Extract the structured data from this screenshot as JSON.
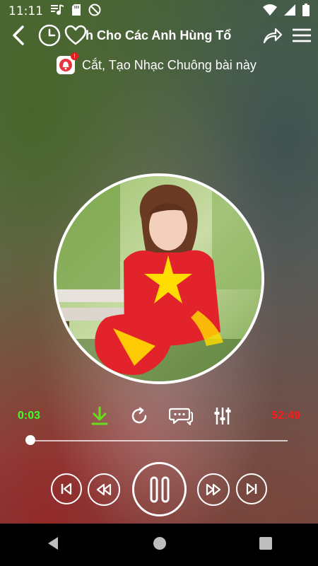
{
  "status_bar": {
    "time": "11:11"
  },
  "toolbar": {
    "song_title_visible": "nh Cho Các Anh Hùng Tổ",
    "icons": [
      "back-arrow-icon",
      "history-clock-icon",
      "favorite-heart-icon",
      "share-icon",
      "menu-icon"
    ]
  },
  "ringtone": {
    "label": "Cắt, Tạo Nhạc Chuông bài này",
    "badge": "!"
  },
  "player": {
    "current_time": "0:03",
    "duration": "52:49",
    "progress_fraction": 0.001,
    "colors": {
      "current_time": "#3cff28",
      "duration": "#ff1a1a",
      "download": "#66e01a"
    }
  },
  "system_nav": {
    "icons": [
      "back-triangle-icon",
      "home-circle-icon",
      "recents-square-icon"
    ]
  }
}
